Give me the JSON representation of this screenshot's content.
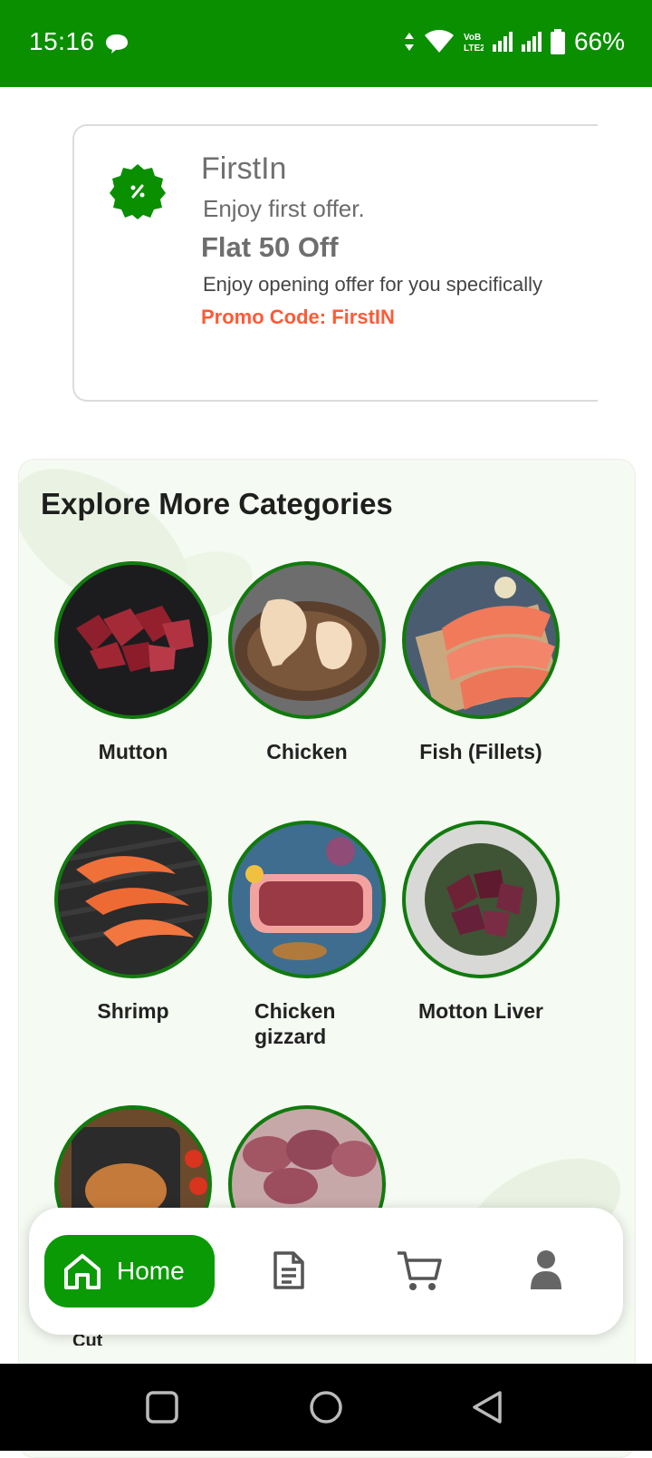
{
  "status_bar": {
    "time": "15:16",
    "battery": "66%",
    "icons": [
      "chat-bubble-icon",
      "data-arrows-icon",
      "wifi-icon",
      "volte-icon",
      "signal-icon",
      "signal-icon-2",
      "battery-icon"
    ]
  },
  "offer": {
    "title": "FirstIn",
    "subtitle": "Enjoy first offer.",
    "headline": "Flat 50 Off",
    "description": "Enjoy opening offer for you specifically",
    "promo": "Promo Code: FirstIN",
    "icon": "discount-badge-icon"
  },
  "categories": {
    "title": "Explore More Categories",
    "items": [
      {
        "label": "Mutton"
      },
      {
        "label": "Chicken"
      },
      {
        "label": "Fish (Fillets)"
      },
      {
        "label": "Shrimp"
      },
      {
        "label": "Chicken gizzard"
      },
      {
        "label": "Motton Liver"
      }
    ],
    "partial_label": "Cut"
  },
  "bottom_nav": {
    "home_label": "Home",
    "items": [
      "home-icon",
      "orders-icon",
      "cart-icon",
      "profile-icon"
    ]
  },
  "colors": {
    "brand_green": "#0a8f00",
    "accent_orange": "#ff5a36",
    "panel_bg": "#f5faf2"
  }
}
